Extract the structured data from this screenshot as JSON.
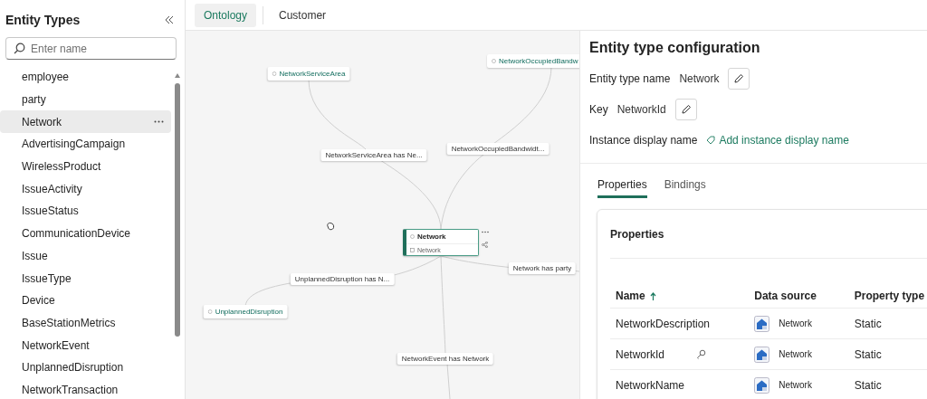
{
  "sidebar": {
    "title": "Entity Types",
    "search": {
      "placeholder": "Enter name"
    },
    "items": [
      {
        "label": "employee",
        "selected": false
      },
      {
        "label": "party",
        "selected": false
      },
      {
        "label": "Network",
        "selected": true
      },
      {
        "label": "AdvertisingCampaign",
        "selected": false
      },
      {
        "label": "WirelessProduct",
        "selected": false
      },
      {
        "label": "IssueActivity",
        "selected": false
      },
      {
        "label": "IssueStatus",
        "selected": false
      },
      {
        "label": "CommunicationDevice",
        "selected": false
      },
      {
        "label": "Issue",
        "selected": false
      },
      {
        "label": "IssueType",
        "selected": false
      },
      {
        "label": "Device",
        "selected": false
      },
      {
        "label": "BaseStationMetrics",
        "selected": false
      },
      {
        "label": "NetworkEvent",
        "selected": false
      },
      {
        "label": "UnplannedDisruption",
        "selected": false
      },
      {
        "label": "NetworkTransaction",
        "selected": false
      }
    ]
  },
  "tabs": [
    {
      "label": "Ontology",
      "selected": true
    },
    {
      "label": "Customer",
      "selected": false
    }
  ],
  "graph": {
    "nodes": [
      {
        "kind": "entity",
        "label": "NetworkServiceArea",
        "selected": false
      },
      {
        "kind": "entity",
        "label": "NetworkOccupiedBandw",
        "selected": false
      },
      {
        "kind": "relation",
        "label": "NetworkServiceArea has Ne..."
      },
      {
        "kind": "relation",
        "label": "NetworkOccupiedBandwidt..."
      },
      {
        "kind": "entity",
        "label": "Network",
        "source": "Network",
        "selected": true
      },
      {
        "kind": "relation",
        "label": "UnplannedDisruption has N..."
      },
      {
        "kind": "relation",
        "label": "Network has party"
      },
      {
        "kind": "entity",
        "label": "UnplannedDisruption",
        "selected": false
      },
      {
        "kind": "relation",
        "label": "NetworkEvent has Network"
      }
    ]
  },
  "config": {
    "title": "Entity type configuration",
    "fields": [
      {
        "kind": "editable",
        "label": "Entity type name",
        "value": "Network"
      },
      {
        "kind": "editable",
        "label": "Key",
        "value": "NetworkId"
      },
      {
        "kind": "link",
        "label": "Instance display name",
        "link": "Add instance display name"
      }
    ],
    "tabs": [
      {
        "label": "Properties",
        "selected": true
      },
      {
        "label": "Bindings",
        "selected": false
      }
    ],
    "card": {
      "title": "Properties",
      "columns": [
        {
          "label": "Name",
          "sorted": true
        },
        {
          "label": "Data source",
          "sorted": false
        },
        {
          "label": "Property type",
          "sorted": false
        }
      ],
      "rows": [
        {
          "name": "NetworkDescription",
          "key": false,
          "source": "Network",
          "type": "Static"
        },
        {
          "name": "NetworkId",
          "key": true,
          "source": "Network",
          "type": "Static"
        },
        {
          "name": "NetworkName",
          "key": false,
          "source": "Network",
          "type": "Static"
        }
      ]
    }
  }
}
